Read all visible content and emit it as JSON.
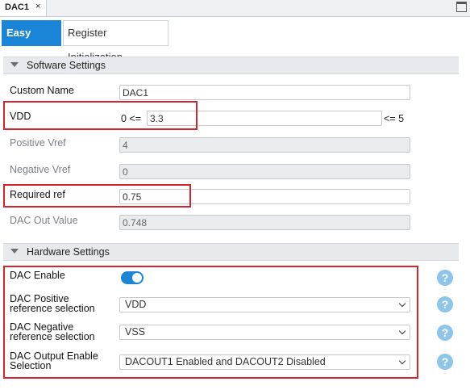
{
  "doc_tab": {
    "label": "DAC1",
    "close": "×"
  },
  "view_tabs": {
    "easy": "Easy View",
    "register": "Register Initialization"
  },
  "software": {
    "title": "Software Settings",
    "custom_name": {
      "label": "Custom Name",
      "value": "DAC1"
    },
    "vdd": {
      "label": "VDD",
      "prefix": "0 <=",
      "value": "3.3",
      "suffix": "<= 5"
    },
    "positive_vref": {
      "label": "Positive Vref",
      "value": "4"
    },
    "negative_vref": {
      "label": "Negative Vref",
      "value": "0"
    },
    "required_ref": {
      "label": "Required ref",
      "value": "0.75"
    },
    "dac_out": {
      "label": "DAC Out Value",
      "value": "0.748"
    }
  },
  "hardware": {
    "title": "Hardware Settings",
    "dac_enable": {
      "label": "DAC Enable",
      "enabled": true
    },
    "pos_ref": {
      "label_1": "DAC Positive",
      "label_2": "reference selection",
      "value": "VDD"
    },
    "neg_ref": {
      "label_1": "DAC Negative",
      "label_2": "reference selection",
      "value": "VSS"
    },
    "output_enable": {
      "label_1": "DAC Output Enable",
      "label_2": "Selection",
      "value": "DACOUT1 Enabled and DACOUT2 Disabled"
    },
    "help": "?"
  },
  "colors": {
    "accent": "#1a84d6",
    "highlight": "#d6242e",
    "help": "#8ec5ea"
  }
}
